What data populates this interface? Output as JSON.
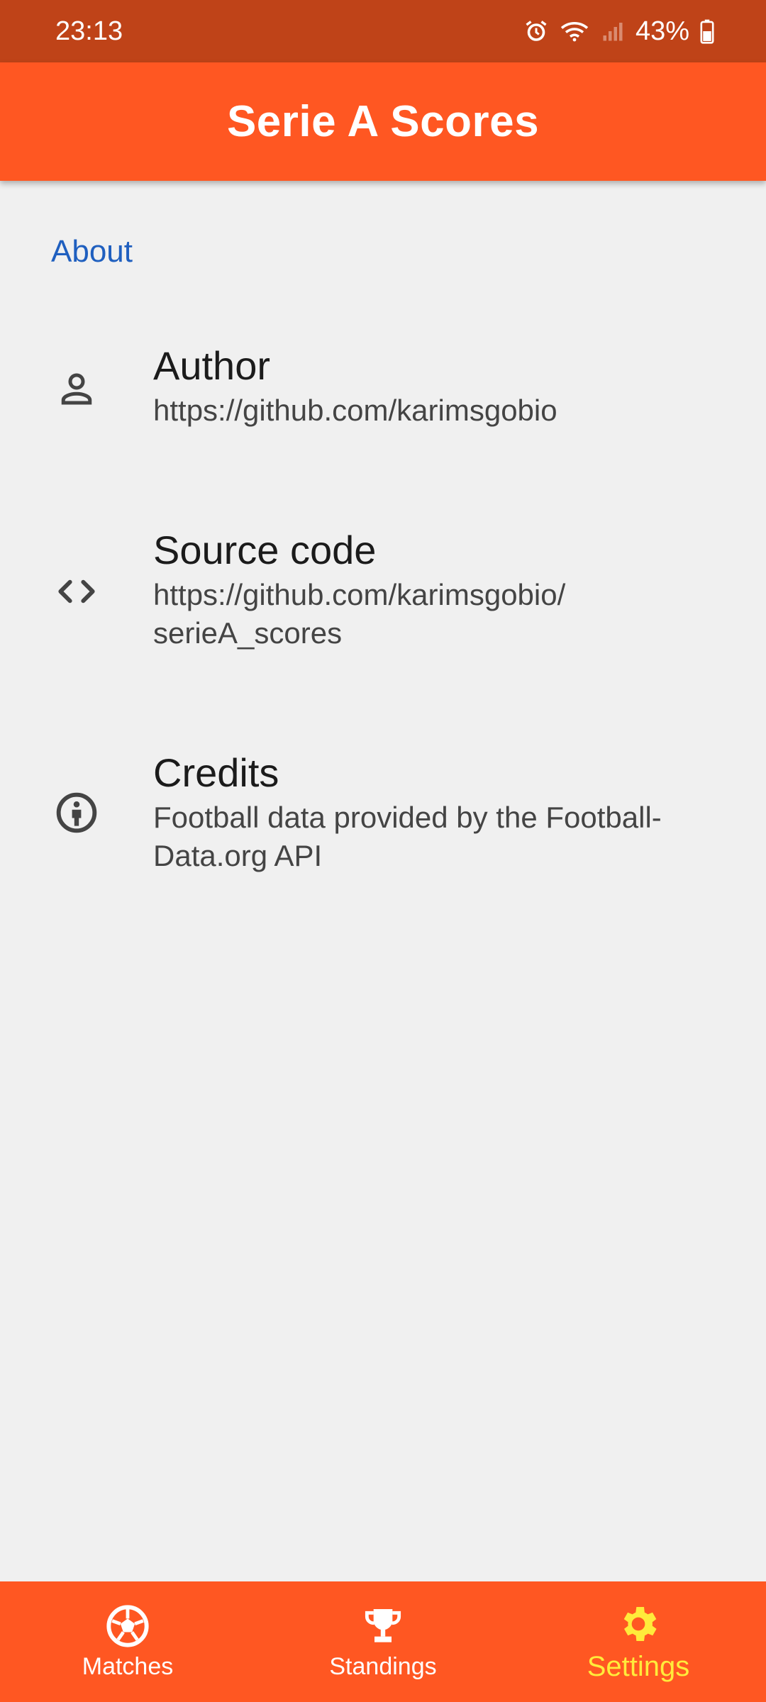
{
  "status_bar": {
    "time": "23:13",
    "battery": "43%",
    "icons": [
      "alarm-icon",
      "wifi-icon",
      "signal-icon",
      "battery-icon"
    ]
  },
  "app_bar": {
    "title": "Serie A Scores"
  },
  "settings": {
    "section_header": "About",
    "items": [
      {
        "icon": "person-icon",
        "title": "Author",
        "subtitle": "https://github.com/karimsgobio"
      },
      {
        "icon": "code-icon",
        "title": "Source code",
        "subtitle": "https://github.com/karimsgobio/\nserieA_scores"
      },
      {
        "icon": "info-icon",
        "title": "Credits",
        "subtitle": "Football data provided by the Football-\nData.org API"
      }
    ]
  },
  "bottom_nav": {
    "items": [
      {
        "label": "Matches",
        "icon": "soccer-ball-icon",
        "active": false
      },
      {
        "label": "Standings",
        "icon": "trophy-icon",
        "active": false
      },
      {
        "label": "Settings",
        "icon": "gear-icon",
        "active": true
      }
    ]
  },
  "colors": {
    "primary": "#ff5722",
    "status_bar": "#bf4318",
    "accent_active": "#ffeb3b",
    "link_blue": "#1f5fbf",
    "background": "#f0f0f0"
  }
}
